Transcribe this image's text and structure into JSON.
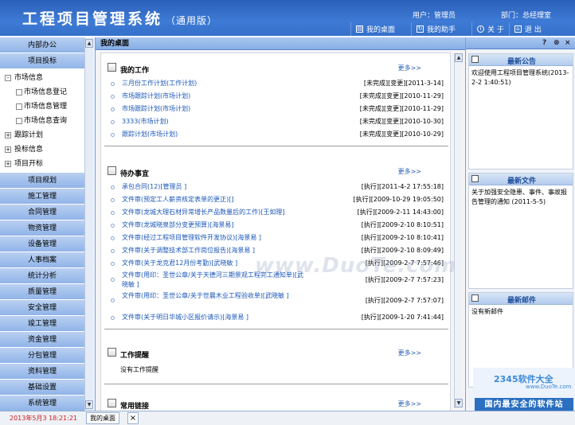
{
  "header": {
    "title": "工程项目管理系统",
    "edition": "（通用版）",
    "user": "用户：管理员",
    "dept": "部门：总经理室",
    "nav": [
      {
        "label": "我的桌面",
        "icon": "desktop-icon"
      },
      {
        "label": "我的助手",
        "icon": "assistant-icon"
      },
      {
        "label": "关 于",
        "icon": "info-icon"
      },
      {
        "label": "退 出",
        "icon": "logout-icon"
      }
    ]
  },
  "sidebar": {
    "top": [
      "内部办公",
      "项目投标"
    ],
    "tree": [
      {
        "label": "市场信息",
        "box": "-",
        "children": [
          "市场信息登记",
          "市场信息管理",
          "市场信息查询"
        ]
      },
      {
        "label": "跟踪计划",
        "box": "+"
      },
      {
        "label": "投标信息",
        "box": "+"
      },
      {
        "label": "项目开标",
        "box": "+"
      }
    ],
    "modules": [
      "项目规划",
      "施工管理",
      "合同管理",
      "物资管理",
      "设备管理",
      "人事档案",
      "统计分析",
      "质量管理",
      "安全管理",
      "竣工管理",
      "资金管理",
      "分包管理",
      "资料管理",
      "基础设置",
      "系统管理"
    ]
  },
  "main": {
    "title": "我的桌面",
    "window_controls": [
      "?",
      "⊗",
      "×"
    ],
    "work": {
      "title": "我的工作",
      "more": "更多>>",
      "items": [
        {
          "text": "三月份工作计划(工作计划)",
          "status": "[未完成]",
          "action": "[变更]",
          "date": "[2011-3-14]"
        },
        {
          "text": "市场跟踪计划(市场计划)",
          "status": "[未完成]",
          "action": "[变更]",
          "date": "[2010-11-29]"
        },
        {
          "text": "市场跟踪计划(市场计划)",
          "status": "[未完成]",
          "action": "[变更]",
          "date": "[2010-11-29]"
        },
        {
          "text": "3333(市场计划)",
          "status": "[未完成]",
          "action": "[变更]",
          "date": "[2010-10-30]"
        },
        {
          "text": "跟踪计划(市场计划)",
          "status": "[未完成]",
          "action": "[变更]",
          "date": "[2010-10-29]"
        }
      ]
    },
    "todo": {
      "title": "待办事宜",
      "more": "更多>>",
      "items": [
        {
          "text": "承包合同(12)[管理员 ]",
          "status": "[执行]",
          "date": "[2011-4-2 17:55:18]"
        },
        {
          "text": "文件审(预定工人薪资核定表单的更正)[]",
          "status": "[执行]",
          "date": "[2009-10-29 19:05:50]"
        },
        {
          "text": "文件审(龙城大理石材异常增长产品数量后的工作)[王如理]",
          "status": "[执行]",
          "date": "[2009-2-11 14:43:00]"
        },
        {
          "text": "文件审(龙城晓泉部分变更预算)[海景易]",
          "status": "[执行]",
          "date": "[2009-2-10 8:10:51]"
        },
        {
          "text": "文件审(经过工程项目管理软件开发协议)[海景易 ]",
          "status": "[执行]",
          "date": "[2009-2-10 8:10:41]"
        },
        {
          "text": "文件审(关于调整技术部工作岗位报告)[海景易 ]",
          "status": "[执行]",
          "date": "[2009-2-10 8:09:49]"
        },
        {
          "text": "文件审(关于龙克君12月份考勤)[武晓敏 ]",
          "status": "[执行]",
          "date": "[2009-2-7 7:57:46]"
        },
        {
          "text": "文件审(用印：圣世公章/关于天德河三期景观工程完工通知单)[武晓敏 ]",
          "status": "[执行]",
          "date": "[2009-2-7 7:57:23]",
          "tall": true
        },
        {
          "text": "文件审(用印：圣世公章/关于世晨木业工程验收单)[武晓敏 ]",
          "status": "[执行]",
          "date": "[2009-2-7 7:57:07]",
          "tall": true
        },
        {
          "text": "文件审(关于明日华城小区报价请示)[海景易 ]",
          "status": "[执行]",
          "date": "[2009-1-20 7:41:44]"
        }
      ]
    },
    "remind": {
      "title": "工作提醒",
      "more": "更多>>",
      "empty": "没有工作提醒"
    },
    "common": {
      "title": "常用链接",
      "more": "更多>>"
    }
  },
  "right": {
    "controls": [
      "?",
      "⊗",
      "×"
    ],
    "notice": {
      "title": "最新公告",
      "body": "欢迎使用工程项目管理系统(2013-2-2 1:40:51)"
    },
    "files": {
      "title": "最新文件",
      "body": "关于加强安全隐患、事件、事故报告管理的通知 (2011-5-5)"
    },
    "mail": {
      "title": "最新邮件",
      "body": "没有新邮件"
    }
  },
  "watermarks": {
    "center": "www.DuoTe.com",
    "logo": "2345软件大全",
    "site": "www.DuoTe.com",
    "slogan": "国内最安全的软件站"
  },
  "status": {
    "time": "2013年5月3 18:21:21",
    "tab": "我的桌面",
    "close": "×"
  }
}
